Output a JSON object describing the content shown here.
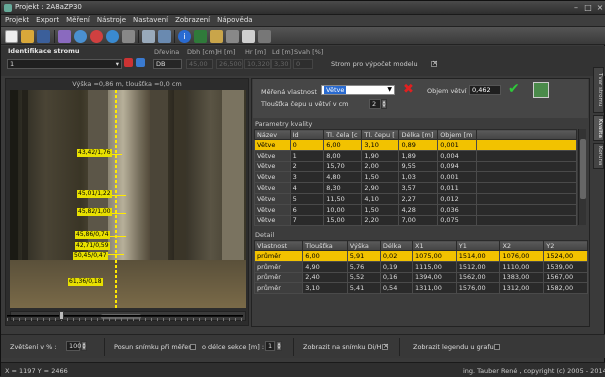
{
  "window": {
    "title": "Projekt : 2A8aZP30"
  },
  "menu": [
    "Projekt",
    "Export",
    "Měření",
    "Nástroje",
    "Nastavení",
    "Zobrazení",
    "Nápověda"
  ],
  "toolbar_icons": [
    "new-file-icon",
    "open-folder-icon",
    "save-icon",
    "wizard-icon",
    "refresh-icon",
    "add-icon",
    "globe-icon",
    "cut-icon",
    "screen-icon",
    "monitor-icon",
    "info-icon",
    "tree-icon",
    "measure-icon",
    "calculator-icon",
    "table-icon",
    "settings-icon"
  ],
  "id_panel": {
    "tree_id_label": "Identifikace stromu",
    "tree_id_value": "1",
    "species_label": "Dřevina",
    "species_value": "DB",
    "dbh_label": "Dbh [cm]",
    "dbh_value": "45,00",
    "h_label": "H [m]",
    "h_value": "26,500",
    "hr_label": "Hr [m]",
    "hr_value": "10,320",
    "ld_label": "Ld [m]",
    "ld_value": "3,30",
    "svah_label": "Svah [%]",
    "svah_value": "0",
    "model_label": "Strom pro výpočet modelu"
  },
  "viewer": {
    "header": "Výška =0,86 m, tloušťka =0,0 cm",
    "labels": [
      "43,42/1,76",
      "45,01/1,22",
      "45,82/1,00",
      "45,86/0,74",
      "42,71/0,59",
      "50,45/0,47",
      "61,36/0,18"
    ]
  },
  "props": {
    "measured_label": "Měřená vlastnost",
    "measured_value": "Větve",
    "volume_label": "Objem větví",
    "volume_value": "0,462",
    "stub_label": "Tloušťka čepu u větví v cm",
    "stub_value": "2"
  },
  "params": {
    "title": "Parametry kvality",
    "columns": [
      "Název",
      "Id",
      "Tl. čela [c",
      "Tl. čepu [",
      "Délka [m]",
      "Objem [m"
    ],
    "rows": [
      [
        "Větve",
        "0",
        "6,00",
        "3,10",
        "0,89",
        "0,001"
      ],
      [
        "Větve",
        "1",
        "8,00",
        "1,90",
        "1,89",
        "0,004"
      ],
      [
        "Větve",
        "2",
        "15,70",
        "2,00",
        "9,55",
        "0,094"
      ],
      [
        "Větve",
        "3",
        "4,80",
        "1,50",
        "1,03",
        "0,001"
      ],
      [
        "Větve",
        "4",
        "8,30",
        "2,90",
        "3,57",
        "0,011"
      ],
      [
        "Větve",
        "5",
        "11,50",
        "4,10",
        "2,27",
        "0,012"
      ],
      [
        "Větve",
        "6",
        "10,00",
        "1,50",
        "4,28",
        "0,036"
      ],
      [
        "Větve",
        "7",
        "15,00",
        "2,20",
        "7,00",
        "0,075"
      ]
    ]
  },
  "detail": {
    "title": "Detail",
    "columns": [
      "Vlastnost",
      "Tloušťka",
      "Výška",
      "Délka",
      "X1",
      "Y1",
      "X2",
      "Y2"
    ],
    "rows": [
      [
        "průměr",
        "6,00",
        "5,91",
        "0,02",
        "1075,00",
        "1514,00",
        "1076,00",
        "1524,00"
      ],
      [
        "průměr",
        "4,90",
        "5,76",
        "0,19",
        "1115,00",
        "1512,00",
        "1110,00",
        "1539,00"
      ],
      [
        "průměr",
        "2,40",
        "5,52",
        "0,16",
        "1394,00",
        "1562,00",
        "1383,00",
        "1567,00"
      ],
      [
        "průměr",
        "3,10",
        "5,41",
        "0,54",
        "1311,00",
        "1576,00",
        "1312,00",
        "1582,00"
      ]
    ]
  },
  "side_tabs": [
    "Tvar stromu",
    "Kvalita",
    "Koruna"
  ],
  "bottom": {
    "zoom_label": "Zvětšení v % :",
    "zoom_value": "100",
    "move_label": "Posun snímku při měření",
    "section_label": "o délce sekce [m] :",
    "section_value": "1",
    "show_dh_label": "Zobrazit na snímku Di/Hi",
    "legend_label": "Zobrazit legendu u grafu"
  },
  "status": {
    "coords": "X = 1197   Y = 2466",
    "copyright": "ing. Tauber René , copyright (c) 2005 - 2014"
  }
}
